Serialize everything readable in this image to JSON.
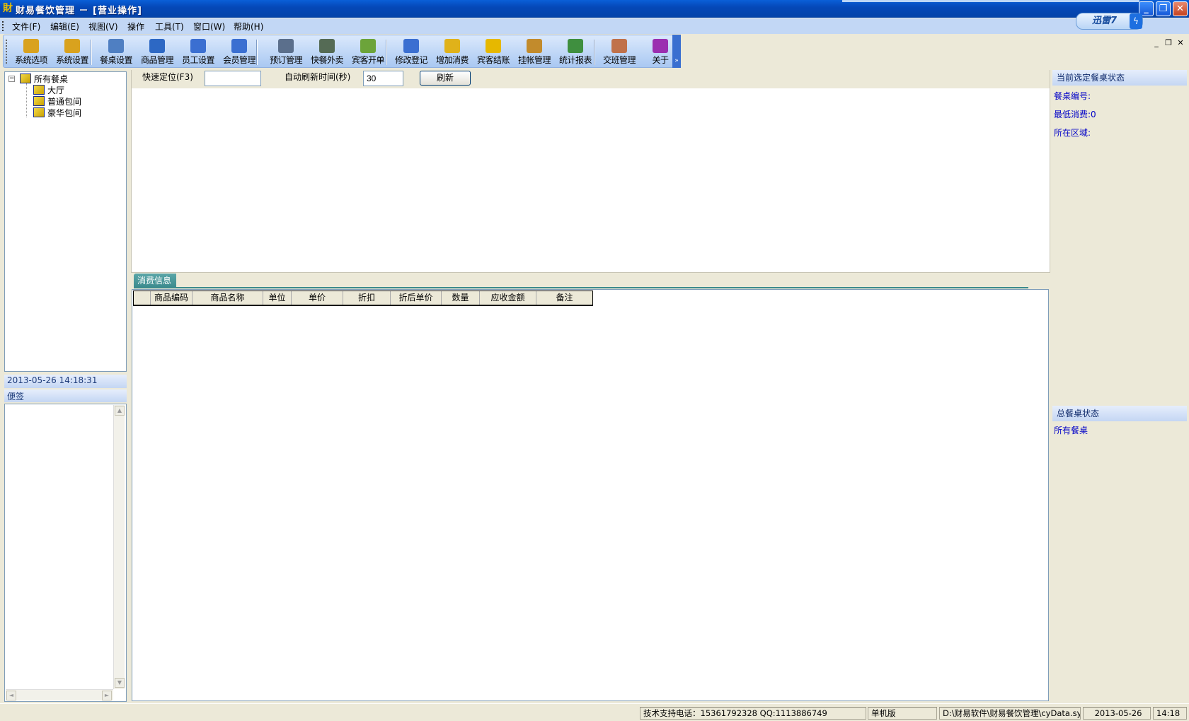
{
  "window": {
    "title": "财易餐饮管理 － [营业操作]",
    "app_icon_glyph": "財"
  },
  "window_buttons": {
    "minimize": "_",
    "restore": "❐",
    "close": "✕"
  },
  "menubar": {
    "items": [
      "文件(F)",
      "编辑(E)",
      "视图(V)",
      "操作",
      "工具(T)",
      "窗口(W)",
      "帮助(H)"
    ],
    "mdi_buttons": [
      "_",
      "❐",
      "✕"
    ]
  },
  "xunlei": {
    "label": "迅雷7",
    "bolt": "ϟ"
  },
  "toolbar": {
    "buttons": [
      {
        "label": "系统选项",
        "icon": "hammer-icon",
        "color": "#d9a21e"
      },
      {
        "label": "系统设置",
        "icon": "hammer-icon",
        "color": "#d9a21e"
      },
      {
        "label": "餐桌设置",
        "icon": "table-icon",
        "color": "#4f7fc2"
      },
      {
        "label": "商品管理",
        "icon": "box-icon",
        "color": "#2d68c4"
      },
      {
        "label": "员工设置",
        "icon": "user-icon",
        "color": "#3b6fd1"
      },
      {
        "label": "会员管理",
        "icon": "member-icon",
        "color": "#3b6fd1"
      },
      {
        "label": "预订管理",
        "icon": "book-icon",
        "color": "#5b6f8c"
      },
      {
        "label": "快餐外卖",
        "icon": "phone-icon",
        "color": "#556b55"
      },
      {
        "label": "宾客开单",
        "icon": "gift-icon",
        "color": "#6ca43a"
      },
      {
        "label": "修改登记",
        "icon": "edit-user-icon",
        "color": "#3b6fd1"
      },
      {
        "label": "增加消费",
        "icon": "add-icon",
        "color": "#e0b21a"
      },
      {
        "label": "宾客结账",
        "icon": "yen-coin-icon",
        "color": "#e6b800"
      },
      {
        "label": "挂帐管理",
        "icon": "money-bag-icon",
        "color": "#c28b2c"
      },
      {
        "label": "统计报表",
        "icon": "bar-chart-icon",
        "color": "#3f8f3f"
      },
      {
        "label": "交班管理",
        "icon": "handover-icon",
        "color": "#c0714a"
      },
      {
        "label": "关于",
        "icon": "help-icon",
        "color": "#9b2fb0"
      }
    ],
    "chevron": "»"
  },
  "tree": {
    "root": "所有餐桌",
    "children": [
      "大厅",
      "普通包间",
      "豪华包间"
    ],
    "expander": "−"
  },
  "datetime": "2013-05-26  14:18:31",
  "memo": {
    "title": "便签",
    "up": "▲",
    "down": "▼",
    "left": "◄",
    "right": "►"
  },
  "locate": {
    "label": "快速定位(F3)",
    "value": "",
    "refresh_label": "自动刷新时间(秒)",
    "refresh_value": "30",
    "refresh_button": "刷新"
  },
  "consume_tab": "消费信息",
  "grid": {
    "columns": [
      "",
      "商品编码",
      "商品名称",
      "单位",
      "单价",
      "折扣",
      "折后单价",
      "数量",
      "应收金额",
      "备注"
    ]
  },
  "right_panel": {
    "selected_title": "当前选定餐桌状态",
    "table_no_label": "餐桌编号:",
    "min_spend_label": "最低消费:0",
    "area_label": "所在区域:",
    "total_title": "总餐桌状态",
    "all_tables": "所有餐桌"
  },
  "statusbar": {
    "support": "技术支持电话：15361792328 QQ:1113886749",
    "edition": "单机版",
    "path": "D:\\财易软件\\财易餐饮管理\\cyData.sy",
    "date": "2013-05-26",
    "time": "14:18"
  }
}
